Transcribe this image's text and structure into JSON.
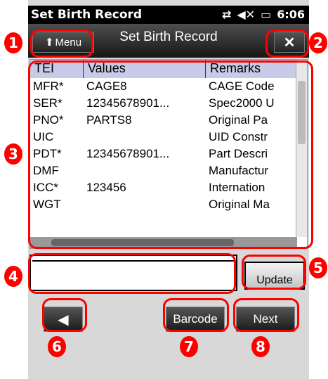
{
  "status": {
    "title": "Set Birth Record",
    "sync_icon": "sync-arrows-icon",
    "volume_icon": "muted-speaker-icon",
    "battery_icon": "battery-icon",
    "time": "6:06"
  },
  "header": {
    "menu_label": "Menu",
    "title": "Set Birth Record",
    "close_label": "✕"
  },
  "grid": {
    "columns": [
      "TEI",
      "Values",
      "Remarks"
    ],
    "rows": [
      {
        "tei": "MFR*",
        "value": "CAGE8",
        "remark": "CAGE Code"
      },
      {
        "tei": "SER*",
        "value": "12345678901...",
        "remark": "Spec2000 U"
      },
      {
        "tei": "PNO*",
        "value": "PARTS8",
        "remark": "Original Pa"
      },
      {
        "tei": "UIC",
        "value": "",
        "remark": "UID Constr"
      },
      {
        "tei": "PDT*",
        "value": "12345678901...",
        "remark": "Part Descri"
      },
      {
        "tei": "DMF",
        "value": "",
        "remark": "Manufactur"
      },
      {
        "tei": "ICC*",
        "value": "123456",
        "remark": "Internation"
      },
      {
        "tei": "WGT",
        "value": "",
        "remark": "Original Ma"
      }
    ]
  },
  "input": {
    "value": ""
  },
  "buttons": {
    "update": "Update",
    "back_icon": "back-arrow-icon",
    "barcode": "Barcode",
    "next": "Next"
  },
  "callouts": [
    "1",
    "2",
    "3",
    "4",
    "5",
    "6",
    "7",
    "8"
  ],
  "colors": {
    "callout": "#ff0000",
    "header_row": "#c8cbe7"
  }
}
